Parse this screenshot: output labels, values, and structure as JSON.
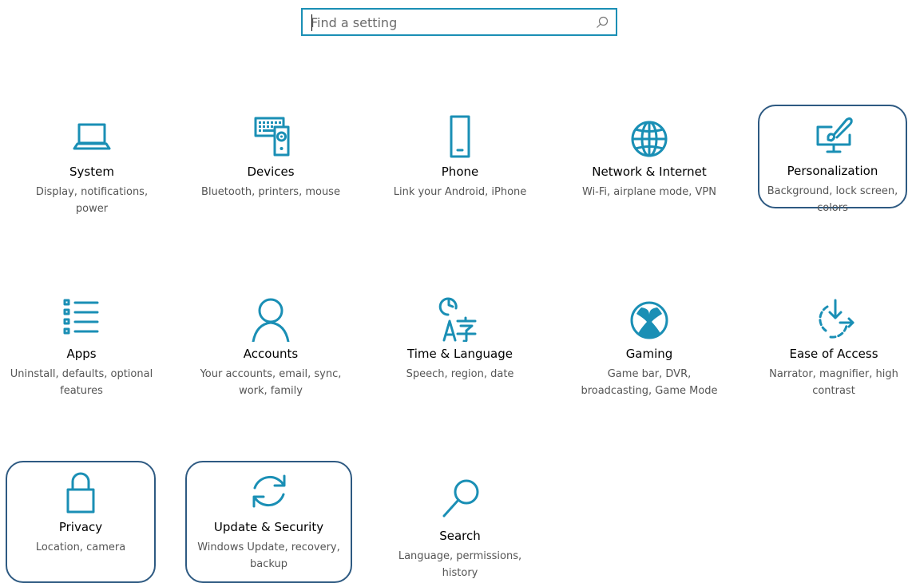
{
  "search": {
    "placeholder": "Find a setting",
    "icon": "search-icon"
  },
  "accent_color": "#1a8fb5",
  "highlight_color": "#2e5a82",
  "tiles": [
    {
      "title": "System",
      "desc1": "Display, notifications,",
      "desc2": "power",
      "icon": "laptop-icon"
    },
    {
      "title": "Devices",
      "desc1": "Bluetooth, printers, mouse",
      "desc2": "",
      "icon": "keyboard-speaker-icon"
    },
    {
      "title": "Phone",
      "desc1": "Link your Android, iPhone",
      "desc2": "",
      "icon": "phone-icon"
    },
    {
      "title": "Network & Internet",
      "desc1": "Wi-Fi, airplane mode, VPN",
      "desc2": "",
      "icon": "globe-icon"
    },
    {
      "title": "Personalization",
      "desc1": "Background, lock screen,",
      "desc2": "colors",
      "icon": "paintbrush-monitor-icon"
    },
    {
      "title": "Apps",
      "desc1": "Uninstall, defaults, optional",
      "desc2": "features",
      "icon": "app-list-icon"
    },
    {
      "title": "Accounts",
      "desc1": "Your accounts, email, sync,",
      "desc2": "work, family",
      "icon": "person-icon"
    },
    {
      "title": "Time & Language",
      "desc1": "Speech, region, date",
      "desc2": "",
      "icon": "clock-language-icon"
    },
    {
      "title": "Gaming",
      "desc1": "Game bar, DVR,",
      "desc2": "broadcasting, Game Mode",
      "icon": "xbox-icon"
    },
    {
      "title": "Ease of Access",
      "desc1": "Narrator, magnifier, high",
      "desc2": "contrast",
      "icon": "ease-of-access-icon"
    },
    {
      "title": "Privacy",
      "desc1": "Location, camera",
      "desc2": "",
      "icon": "lock-icon"
    },
    {
      "title": "Update & Security",
      "desc1": "Windows Update, recovery,",
      "desc2": "backup",
      "icon": "sync-arrows-icon"
    },
    {
      "title": "Search",
      "desc1": "Language, permissions,",
      "desc2": "history",
      "icon": "magnifier-icon"
    }
  ]
}
